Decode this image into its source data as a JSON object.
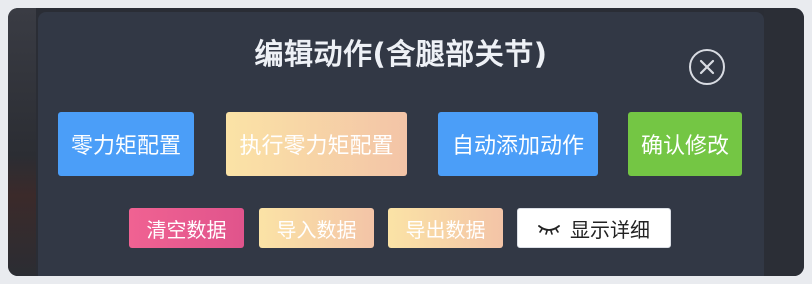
{
  "dialog": {
    "title": "编辑动作(含腿部关节)",
    "close_icon": "circle-x-icon"
  },
  "actions_row1": [
    {
      "label": "零力矩配置",
      "color": "#4b9ef8"
    },
    {
      "label": "执行零力矩配置",
      "color": "#f6d3a6"
    },
    {
      "label": "自动添加动作",
      "color": "#4b9ef8"
    },
    {
      "label": "确认修改",
      "color": "#74c644"
    }
  ],
  "actions_row2": [
    {
      "label": "清空数据",
      "color": "#e85b8f"
    },
    {
      "label": "导入数据",
      "color": "#f6d3a6"
    },
    {
      "label": "导出数据",
      "color": "#f6d3a6"
    },
    {
      "label": "显示详细",
      "icon": "closed-eye-icon",
      "color": "#ffffff"
    }
  ]
}
